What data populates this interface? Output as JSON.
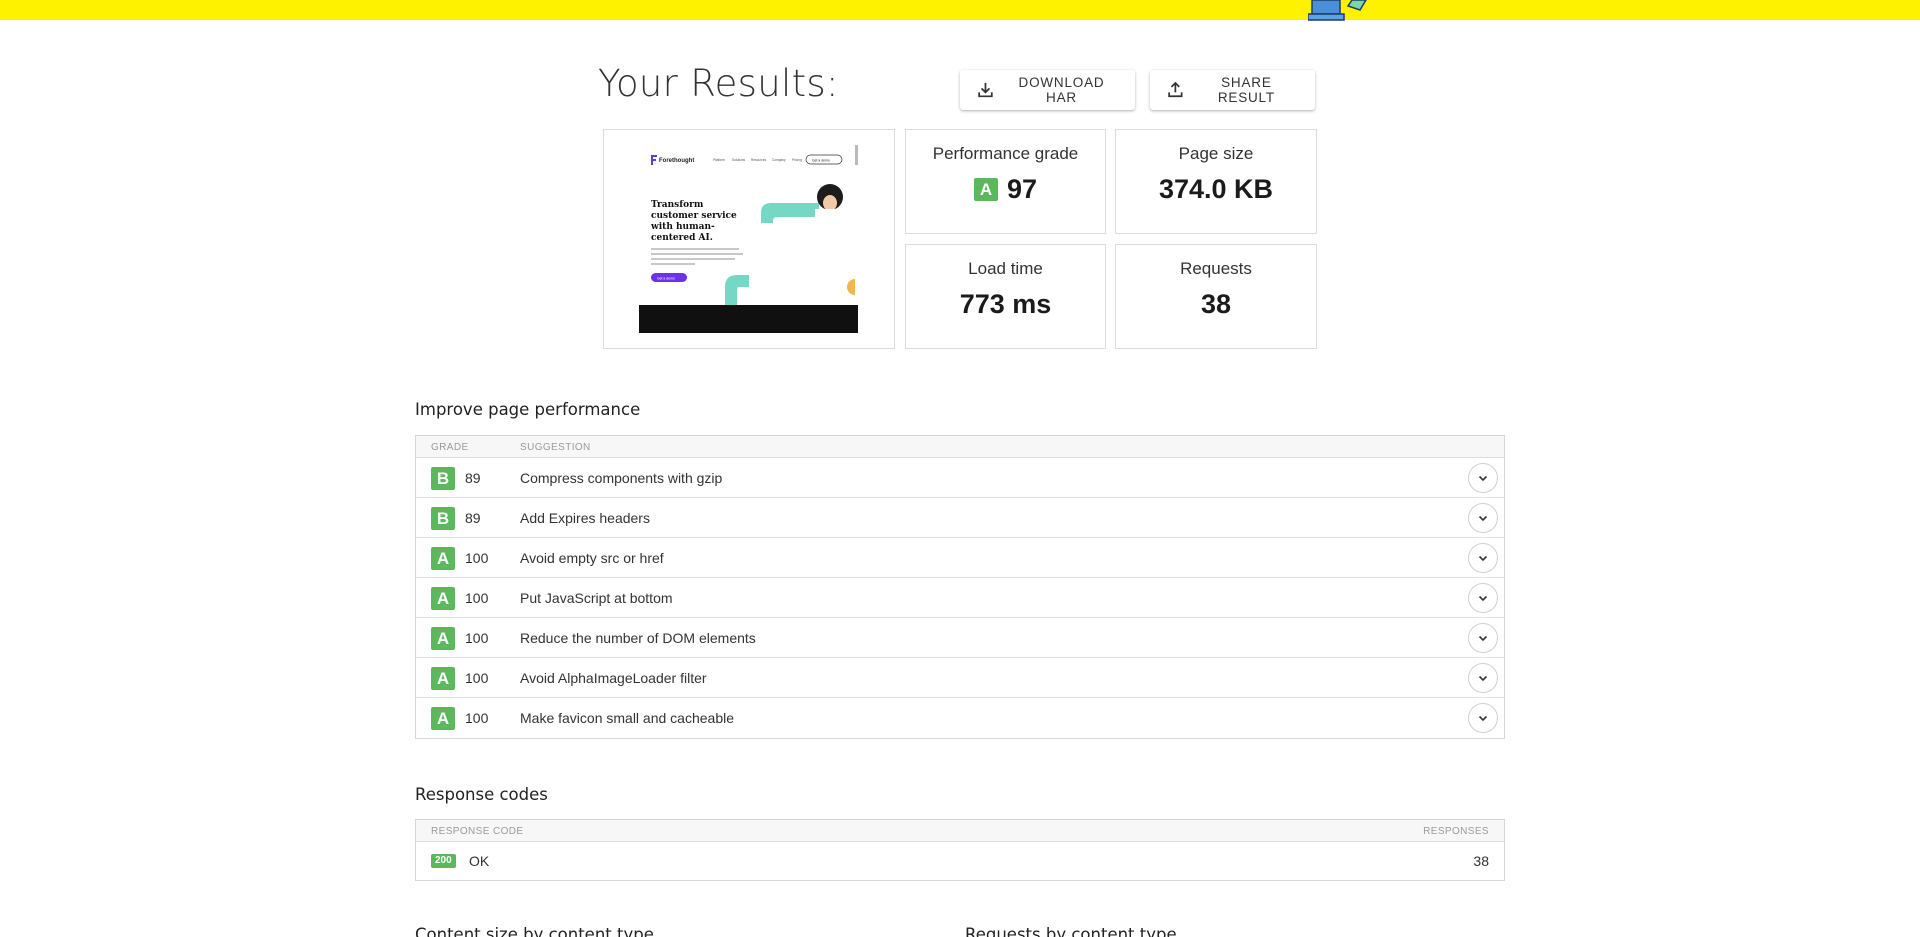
{
  "colors": {
    "banner": "#fff200",
    "grade_green": "#5cb85c"
  },
  "header": {
    "title": "Your Results:",
    "download_label": "DOWNLOAD HAR",
    "share_label": "SHARE RESULT"
  },
  "thumbnail": {
    "brand": "Forethought",
    "nav": [
      "Platform",
      "Solutions",
      "Resources",
      "Company",
      "Pricing"
    ],
    "nav_button": "Get a demo",
    "headline": [
      "Transform",
      "customer service",
      "with human-",
      "centered AI."
    ],
    "cta": "Get a demo"
  },
  "metrics": {
    "grade": {
      "label": "Performance grade",
      "letter": "A",
      "value": "97"
    },
    "size": {
      "label": "Page size",
      "value": "374.0 KB"
    },
    "load": {
      "label": "Load time",
      "value": "773 ms"
    },
    "requests": {
      "label": "Requests",
      "value": "38"
    }
  },
  "improve": {
    "heading": "Improve page performance",
    "columns": [
      "GRADE",
      "SUGGESTION"
    ],
    "rows": [
      {
        "grade": "B",
        "score": "89",
        "suggestion": "Compress components with gzip"
      },
      {
        "grade": "B",
        "score": "89",
        "suggestion": "Add Expires headers"
      },
      {
        "grade": "A",
        "score": "100",
        "suggestion": "Avoid empty src or href"
      },
      {
        "grade": "A",
        "score": "100",
        "suggestion": "Put JavaScript at bottom"
      },
      {
        "grade": "A",
        "score": "100",
        "suggestion": "Reduce the number of DOM elements"
      },
      {
        "grade": "A",
        "score": "100",
        "suggestion": "Avoid AlphaImageLoader filter"
      },
      {
        "grade": "A",
        "score": "100",
        "suggestion": "Make favicon small and cacheable"
      }
    ]
  },
  "response_codes": {
    "heading": "Response codes",
    "columns": [
      "RESPONSE CODE",
      "RESPONSES"
    ],
    "rows": [
      {
        "code": "200",
        "text": "OK",
        "count": "38"
      }
    ]
  },
  "lower_sections": {
    "content_size": "Content size by content type",
    "requests_by_type": "Requests by content type"
  }
}
